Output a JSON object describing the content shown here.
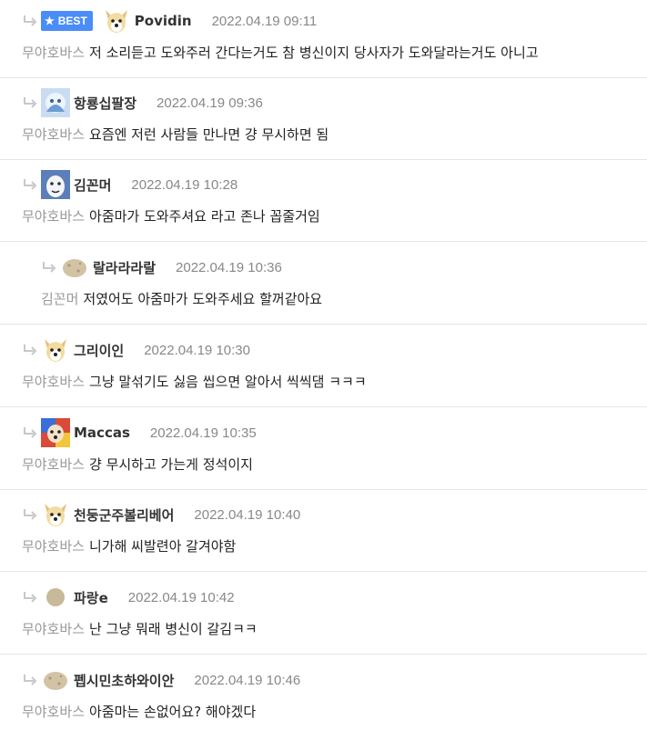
{
  "best_label": "BEST",
  "comments": [
    {
      "nick": "Povidin",
      "time": "2022.04.19 09:11",
      "mention": "무야호바스",
      "text": "저 소리듣고 도와주러 간다는거도 참 병신이지 당사자가 도와달라는거도 아니고",
      "avatar": "dog-avatar"
    },
    {
      "nick": "항룡십팔장",
      "time": "2022.04.19 09:36",
      "mention": "무야호바스",
      "text": "요즘엔 저런 사람들 만나면 걍 무시하면 됨",
      "avatar": "blue-avatar"
    },
    {
      "nick": "김꼰머",
      "time": "2022.04.19 10:28",
      "mention": "무야호바스",
      "text": "아줌마가 도와주셔요 라고 존나 꼽줄거임",
      "avatar": "face-avatar"
    },
    {
      "nick": "랄라라라랄",
      "time": "2022.04.19 10:36",
      "mention": "김꼰머",
      "text": "저였어도 아줌마가 도와주세요 할꺼같아요",
      "avatar": "potato-avatar"
    },
    {
      "nick": "그리이인",
      "time": "2022.04.19 10:30",
      "mention": "무야호바스",
      "text": "그냥 말섞기도 싫음 씹으면 알아서 씩씩댐 ㅋㅋㅋ",
      "avatar": "dog-avatar"
    },
    {
      "nick": "Maccas",
      "time": "2022.04.19 10:35",
      "mention": "무야호바스",
      "text": "걍 무시하고 가는게 정석이지",
      "avatar": "colorful-avatar"
    },
    {
      "nick": "천둥군주볼리베어",
      "time": "2022.04.19 10:40",
      "mention": "무야호바스",
      "text": "니가해 씨발련아 갈겨야함",
      "avatar": "dog-avatar"
    },
    {
      "nick": "파랑e",
      "time": "2022.04.19 10:42",
      "mention": "무야호바스",
      "text": "난 그냥 뭐래 병신이 갈김ㅋㅋ",
      "avatar": "circle-avatar"
    },
    {
      "nick": "펩시민초하와이안",
      "time": "2022.04.19 10:46",
      "mention": "무야호바스",
      "text": "아줌마는 손없어요? 해야겠다",
      "avatar": "potato-avatar"
    }
  ]
}
